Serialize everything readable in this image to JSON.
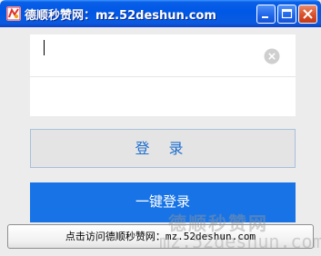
{
  "window": {
    "title": "德顺秒赞网：mz.52deshun.com",
    "icon": "app-logo-icon",
    "buttons": {
      "minimize_icon": "minimize-icon",
      "maximize_icon": "maximize-icon",
      "close_icon": "close-icon"
    }
  },
  "form": {
    "account": {
      "value": "",
      "placeholder": ""
    },
    "password": {
      "value": "",
      "placeholder": ""
    },
    "clear_icon": "clear-circle-icon"
  },
  "buttons": {
    "login_label": "登 录",
    "one_click_label": "一键登录"
  },
  "footer": {
    "link_text_cn": "点击访问德顺秒赞网：",
    "link_text_url": "mz.52deshun.com"
  },
  "watermark": {
    "line1": "德顺秒赞网",
    "line2": "mz.52deshun.com"
  },
  "colors": {
    "titlebar": "#0058e6",
    "accent": "#1874e6",
    "login_text": "#1f6fce"
  }
}
